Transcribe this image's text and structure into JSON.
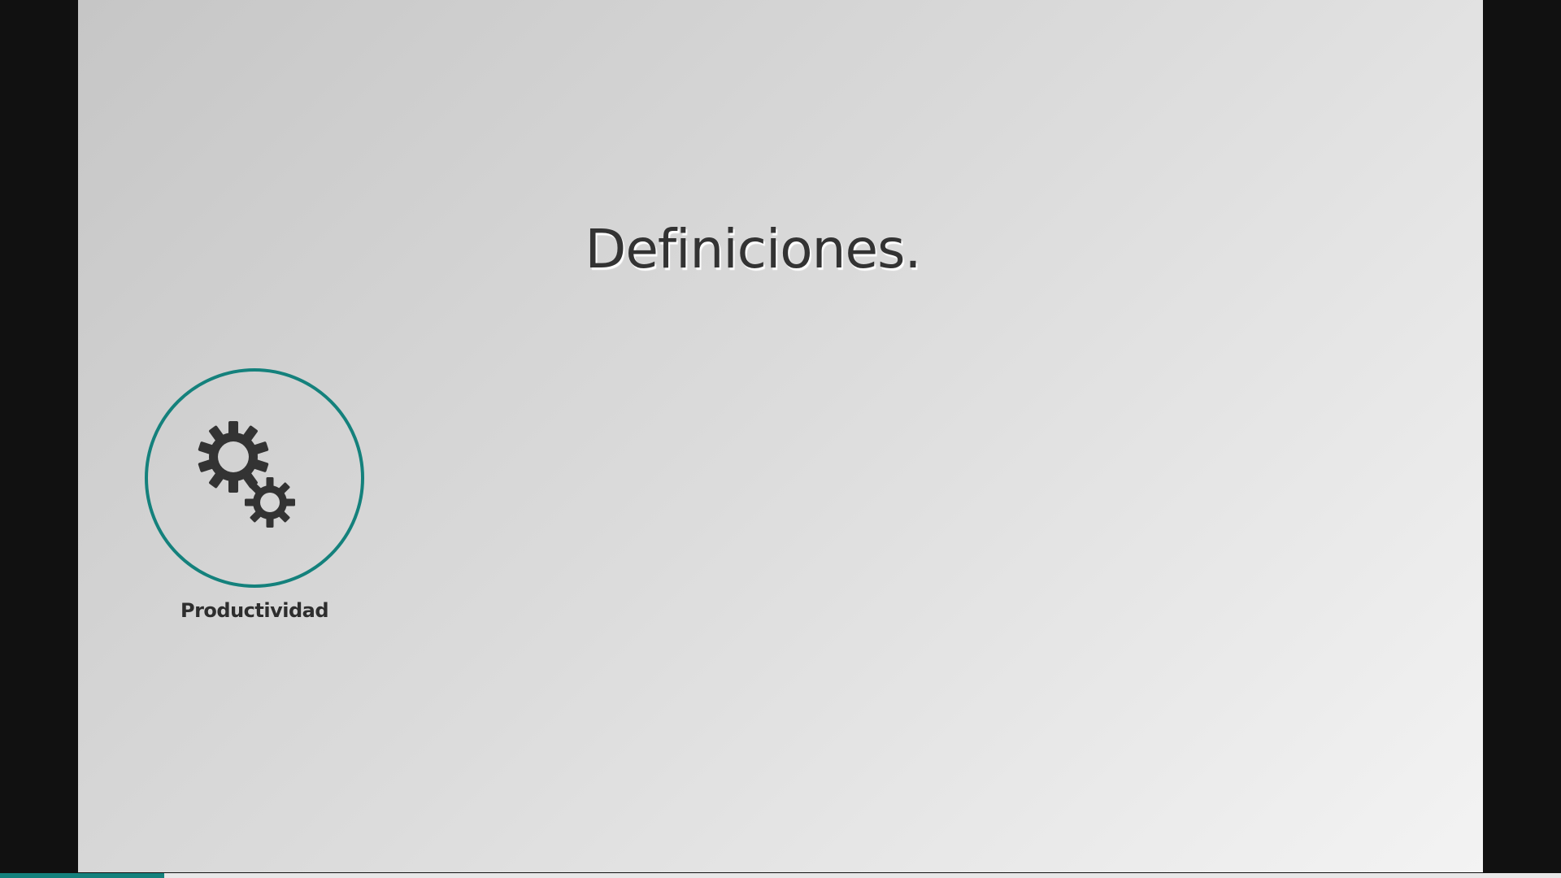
{
  "slide": {
    "title": "Definiciones.",
    "concepts": [
      {
        "label": "Productividad",
        "icon": "gears-icon"
      }
    ]
  },
  "presentation": {
    "progress_fraction": 0.105
  },
  "colors": {
    "accent": "#14817c",
    "text": "#333333",
    "letterbox": "#111111"
  }
}
